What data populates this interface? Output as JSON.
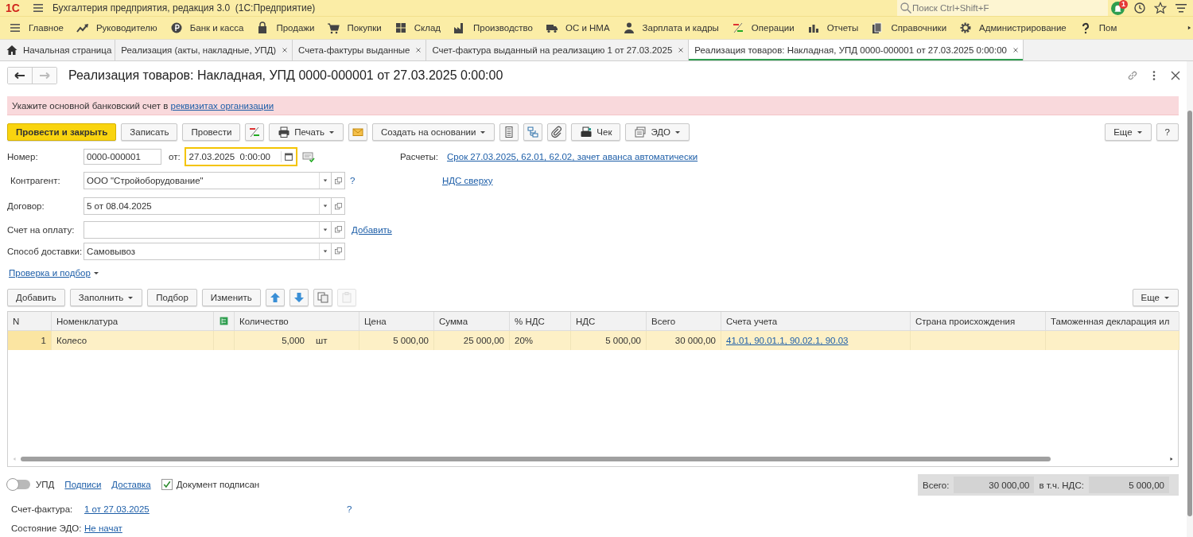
{
  "app": {
    "logo": "1С",
    "title": "Бухгалтерия предприятия, редакция 3.0  (1С:Предприятие)",
    "search_placeholder": "Поиск Ctrl+Shift+F",
    "notifications": "1"
  },
  "sections": [
    {
      "label": "Главное"
    },
    {
      "label": "Руководителю"
    },
    {
      "label": "Банк и касса"
    },
    {
      "label": "Продажи"
    },
    {
      "label": "Покупки"
    },
    {
      "label": "Склад"
    },
    {
      "label": "Производство"
    },
    {
      "label": "ОС и НМА"
    },
    {
      "label": "Зарплата и кадры"
    },
    {
      "label": "Операции"
    },
    {
      "label": "Отчеты"
    },
    {
      "label": "Справочники"
    },
    {
      "label": "Администрирование"
    },
    {
      "label": "Пом"
    }
  ],
  "tabs": [
    {
      "label": "Начальная страница",
      "kind": "home",
      "selected": false
    },
    {
      "label": "Реализация (акты, накладные, УПД)",
      "kind": "closable",
      "selected": false
    },
    {
      "label": "Счета-фактуры выданные",
      "kind": "closable",
      "selected": false
    },
    {
      "label": "Счет-фактура выданный на реализацию 1 от 27.03.2025",
      "kind": "closable",
      "selected": false
    },
    {
      "label": "Реализация товаров: Накладная, УПД 0000-000001 от 27.03.2025 0:00:00",
      "kind": "closable",
      "selected": true
    }
  ],
  "document": {
    "title": "Реализация товаров: Накладная, УПД 0000-000001 от 27.03.2025 0:00:00"
  },
  "alert": {
    "text": "Укажите основной банковский счет в ",
    "link": "реквизитах организации"
  },
  "toolbar": [
    {
      "kind": "primary",
      "label": "Провести и закрыть"
    },
    {
      "kind": "button",
      "label": "Записать"
    },
    {
      "kind": "button",
      "label": "Провести"
    },
    {
      "kind": "icon"
    },
    {
      "kind": "button",
      "label": "Печать",
      "menu": true
    },
    {
      "kind": "icon"
    },
    {
      "kind": "button",
      "label": "Создать на основании",
      "menu": true
    },
    {
      "kind": "icon"
    },
    {
      "kind": "icon"
    },
    {
      "kind": "icon"
    },
    {
      "kind": "button",
      "label": "Чек"
    },
    {
      "kind": "button",
      "label": "ЭДО",
      "menu": true
    }
  ],
  "toolbar_right": [
    {
      "label": "Еще",
      "menu": true
    },
    {
      "label": "?"
    }
  ],
  "number_field": {
    "label": "Номер:",
    "value": "0000-000001"
  },
  "date_field": {
    "label": "от:",
    "value": "27.03.2025  0:00:00",
    "focused": true
  },
  "settlements": {
    "label": "Расчеты:",
    "link": "Срок 27.03.2025, 62.01, 62.02, зачет аванса автоматически"
  },
  "vat_link": "НДС сверху",
  "fields": [
    {
      "label": "Контрагент:",
      "value": "ООО \"Стройоборудование\"",
      "help": "?"
    },
    {
      "label": "Договор:",
      "value": "5 от 08.04.2025"
    },
    {
      "label": "Счет на оплату:",
      "link": "Добавить"
    },
    {
      "label": "Способ доставки:",
      "value": "Самовывоз"
    }
  ],
  "check_link": "Проверка и подбор",
  "table_toolbar": [
    {
      "kind": "button",
      "label": "Добавить",
      "disabled": false
    },
    {
      "kind": "button",
      "label": "Заполнить",
      "menu": true,
      "disabled": false
    },
    {
      "kind": "button",
      "label": "Подбор",
      "disabled": false
    },
    {
      "kind": "button",
      "label": "Изменить",
      "disabled": false
    },
    {
      "kind": "icon",
      "disabled": false
    },
    {
      "kind": "icon",
      "disabled": false
    },
    {
      "kind": "icon",
      "disabled": false
    },
    {
      "kind": "icon",
      "disabled": true
    }
  ],
  "table_toolbar_right": [
    {
      "label": "Еще",
      "menu": true,
      "disabled": false
    }
  ],
  "table": {
    "columns": [
      {
        "title": "N"
      },
      {
        "title": "Номенклатура"
      },
      {
        "kind": "icon"
      },
      {
        "title": "Количество"
      },
      {
        "title": "Цена"
      },
      {
        "title": "Сумма"
      },
      {
        "title": "% НДС"
      },
      {
        "title": "НДС"
      },
      {
        "title": "Всего"
      },
      {
        "title": "Счета учета"
      },
      {
        "title": "Страна происхождения"
      },
      {
        "title": "Таможенная декларация ил"
      }
    ],
    "rows": [
      {
        "selected": true,
        "cells": [
          {
            "kind": "number",
            "text": "1"
          },
          {
            "kind": "text",
            "text": "Колесо"
          },
          {
            "kind": "empty"
          },
          {
            "kind": "quantity",
            "text": "5,000",
            "unit": "шт"
          },
          {
            "kind": "number",
            "text": "5 000,00"
          },
          {
            "kind": "number",
            "text": "25 000,00"
          },
          {
            "kind": "text",
            "text": "20%"
          },
          {
            "kind": "number",
            "text": "5 000,00"
          },
          {
            "kind": "number",
            "text": "30 000,00"
          },
          {
            "kind": "link",
            "text": "41.01, 90.01.1, 90.02.1, 90.03"
          },
          {
            "kind": "empty"
          },
          {
            "kind": "empty"
          }
        ]
      }
    ]
  },
  "footer": {
    "toggle": {
      "label": "УПД",
      "on": false
    },
    "links": [
      "Подписи",
      "Доставка"
    ],
    "signed": {
      "label": "Документ подписан",
      "checked": true
    }
  },
  "totals": [
    {
      "label": "Всего:",
      "value": "30 000,00"
    },
    {
      "label": "в т.ч. НДС:",
      "value": "5 000,00"
    }
  ],
  "bottom_fields": [
    {
      "label": "Счет-фактура:",
      "link": "1 от 27.03.2025",
      "help": "?"
    },
    {
      "label": "Состояние ЭДО:",
      "link": "Не начат"
    }
  ]
}
